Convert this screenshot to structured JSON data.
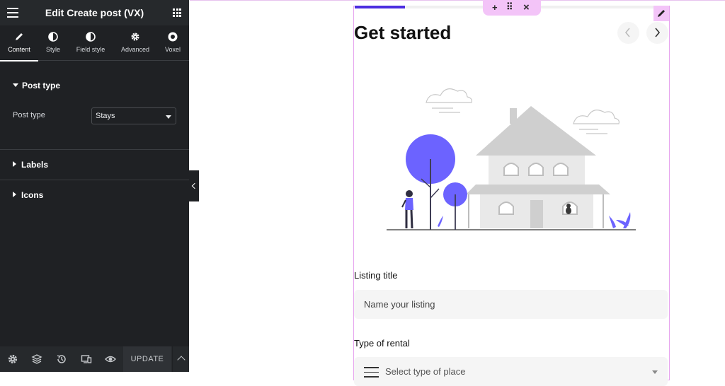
{
  "panel": {
    "title": "Edit Create post (VX)",
    "tabs": [
      {
        "label": "Content",
        "icon": "pencil-icon"
      },
      {
        "label": "Style",
        "icon": "half-circle-icon"
      },
      {
        "label": "Field style",
        "icon": "half-circle-icon"
      },
      {
        "label": "Advanced",
        "icon": "gear-icon"
      },
      {
        "label": "Voxel",
        "icon": "voxel-logo-icon"
      }
    ],
    "sections": [
      {
        "title": "Post type",
        "expanded": true
      },
      {
        "title": "Labels",
        "expanded": false
      },
      {
        "title": "Icons",
        "expanded": false
      }
    ],
    "post_type_field": {
      "label": "Post type",
      "value": "Stays"
    },
    "footer": {
      "icons": [
        "settings-icon",
        "layers-icon",
        "history-icon",
        "responsive-icon",
        "preview-eye-icon"
      ],
      "update_label": "UPDATE"
    }
  },
  "widget": {
    "toolbar": {
      "add": "+",
      "move": "⠿",
      "close": "×"
    },
    "progress": 0.16,
    "step_title": "Get started",
    "fields": {
      "listing_title": {
        "label": "Listing title",
        "placeholder": "Name your listing"
      },
      "type_of_rental": {
        "label": "Type of rental",
        "placeholder": "Select type of place"
      }
    }
  },
  "colors": {
    "accent": "#4c2de0",
    "illustration_purple": "#6c63ff",
    "panel_bg": "#1f2124",
    "widget_outline": "#e7a6ef"
  }
}
